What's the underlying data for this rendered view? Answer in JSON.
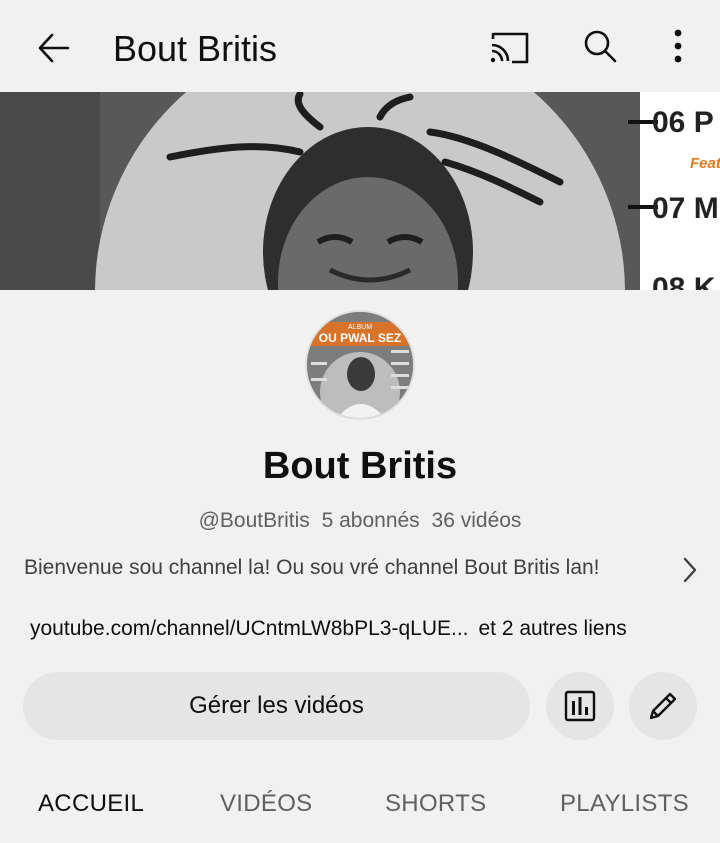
{
  "header": {
    "title": "Bout Britis",
    "icons": [
      "back-arrow-icon",
      "cast-icon",
      "search-icon",
      "more-vert-icon"
    ]
  },
  "banner": {
    "track_lines": [
      "06 P",
      "Feat",
      "07 M",
      "08 K"
    ]
  },
  "avatar": {
    "album_label": "ALBUM",
    "album_title": "OU PWAL SEZ"
  },
  "channel": {
    "name": "Bout Britis",
    "handle": "@BoutBritis",
    "subscribers": "5 abonnés",
    "videos": "36 vidéos",
    "description": "Bienvenue sou channel la! Ou sou vré channel Bout Britis lan!",
    "link": "youtube.com/channel/UCntmLW8bPL3-qLUE...",
    "more_links": "et 2 autres liens"
  },
  "actions": {
    "manage_videos": "Gérer les vidéos",
    "stats_icon": "analytics-icon",
    "edit_icon": "pencil-icon"
  },
  "tabs": [
    {
      "label": "ACCUEIL",
      "active": true
    },
    {
      "label": "VIDÉOS",
      "active": false
    },
    {
      "label": "SHORTS",
      "active": false
    },
    {
      "label": "PLAYLISTS",
      "active": false
    }
  ],
  "colors": {
    "background": "#f1f1f1",
    "button_bg": "#e5e5e5",
    "text_primary": "#0f0f0f",
    "text_secondary": "#606060",
    "banner_accent": "#e07a1c"
  }
}
